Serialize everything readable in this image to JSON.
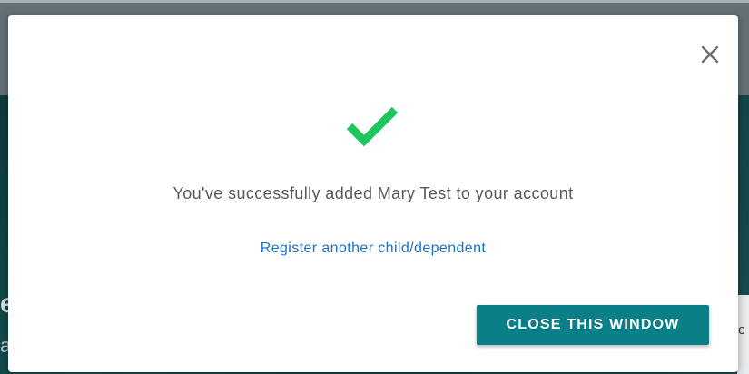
{
  "background": {
    "fragment_left_large": "e",
    "fragment_left_small": "a",
    "fragment_right": "c"
  },
  "modal": {
    "close_icon": "close-icon",
    "success_icon": "checkmark-icon",
    "message": "You've successfully added Mary Test to your account",
    "secondary_link": "Register another child/dependent",
    "primary_button": "CLOSE THIS WINDOW"
  },
  "colors": {
    "accent": "#0b7f87",
    "success": "#1ec55e",
    "link": "#1a73c9",
    "text": "#555a5e"
  }
}
